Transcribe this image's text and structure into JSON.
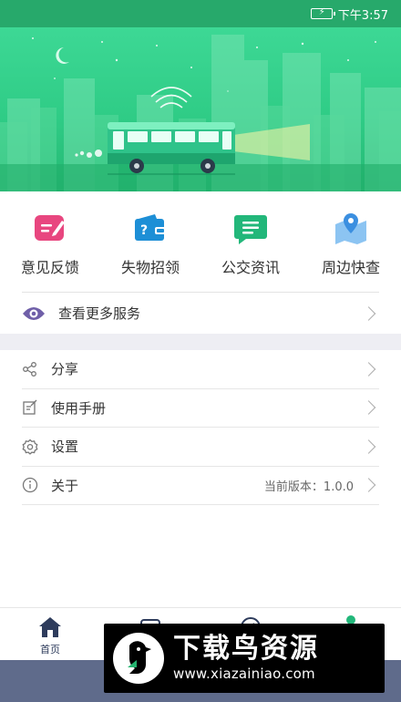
{
  "status_bar": {
    "time": "下午3:57"
  },
  "services": [
    {
      "label": "意见反馈",
      "icon": "feedback-edit-icon",
      "color": "#e8467f"
    },
    {
      "label": "失物招领",
      "icon": "lost-found-icon",
      "color": "#1d8fd6"
    },
    {
      "label": "公交资讯",
      "icon": "news-chat-icon",
      "color": "#22b77a"
    },
    {
      "label": "周边快查",
      "icon": "map-pin-icon",
      "color": "#3b8fe0"
    }
  ],
  "more_services": {
    "label": "查看更多服务",
    "icon": "eye-icon",
    "color": "#6f5fa8"
  },
  "menu": [
    {
      "label": "分享",
      "icon": "share-icon"
    },
    {
      "label": "使用手册",
      "icon": "manual-edit-icon"
    },
    {
      "label": "设置",
      "icon": "gear-icon"
    },
    {
      "label": "关于",
      "icon": "info-icon",
      "value": "当前版本：1.0.0"
    }
  ],
  "tabs": [
    {
      "label": "首页",
      "icon": "home-icon",
      "active": true
    },
    {
      "label": "",
      "icon": "card-icon"
    },
    {
      "label": "",
      "icon": "compass-icon"
    },
    {
      "label": "",
      "icon": "profile-icon"
    }
  ],
  "watermark": {
    "title": "下载鸟资源",
    "url": "www.xiazainiao.com"
  },
  "colors": {
    "primary": "#27a96b",
    "banner": "#3dd895",
    "tab_active": "#2e3c5c"
  }
}
